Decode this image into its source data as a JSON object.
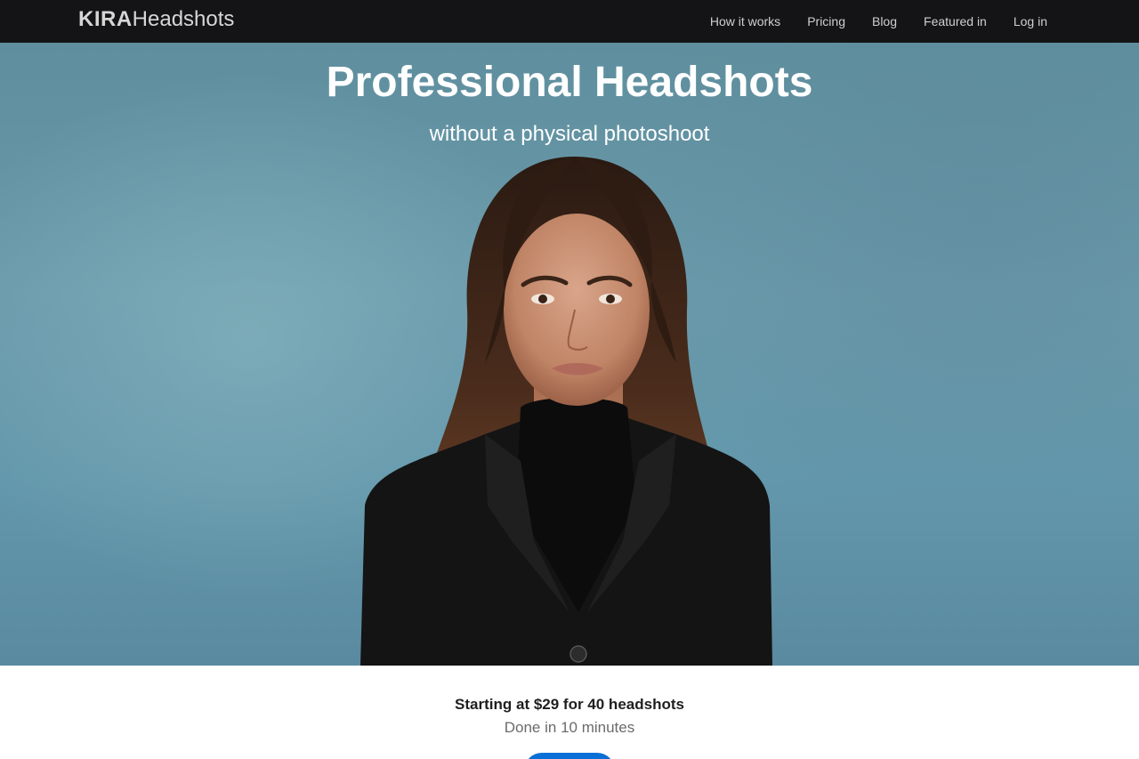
{
  "brand": {
    "bold": "KIRA",
    "regular": "Headshots"
  },
  "nav": [
    {
      "label": "How it works"
    },
    {
      "label": "Pricing"
    },
    {
      "label": "Blog"
    },
    {
      "label": "Featured in"
    },
    {
      "label": "Log in"
    }
  ],
  "hero": {
    "title": "Professional Headshots",
    "subtitle": "without a physical photoshoot",
    "image": "professional-headshot-photo"
  },
  "pricing": {
    "price_line": "Starting at $29 for 40 headshots",
    "time_line": "Done in 10 minutes"
  },
  "colors": {
    "navbar": "#141416",
    "cta": "#0a6fd6",
    "hero_bg": "#6a9aab"
  }
}
